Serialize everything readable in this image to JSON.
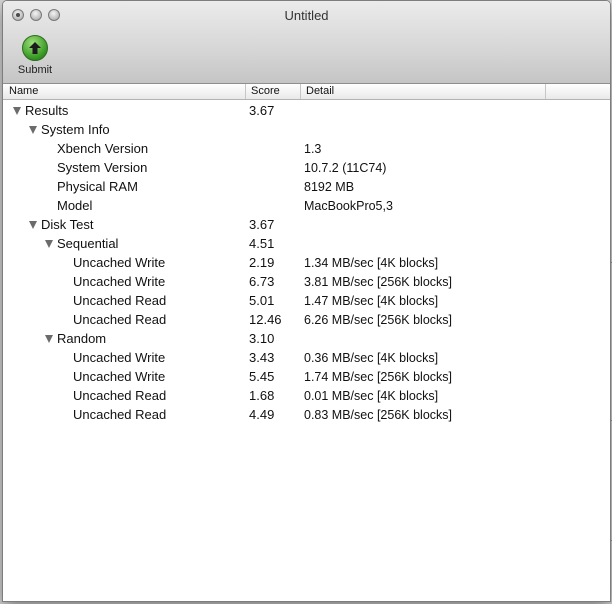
{
  "window": {
    "title": "Untitled"
  },
  "toolbar": {
    "submit_label": "Submit"
  },
  "columns": {
    "name": "Name",
    "score": "Score",
    "detail": "Detail"
  },
  "rows": [
    {
      "name": "Results",
      "score": "3.67",
      "detail": "",
      "level": 0,
      "expanded": true
    },
    {
      "name": "System Info",
      "score": "",
      "detail": "",
      "level": 1,
      "expanded": true
    },
    {
      "name": "Xbench Version",
      "score": "",
      "detail": "1.3",
      "level": 2
    },
    {
      "name": "System Version",
      "score": "",
      "detail": "10.7.2 (11C74)",
      "level": 2
    },
    {
      "name": "Physical RAM",
      "score": "",
      "detail": "8192 MB",
      "level": 2
    },
    {
      "name": "Model",
      "score": "",
      "detail": "MacBookPro5,3",
      "level": 2
    },
    {
      "name": "Disk Test",
      "score": "3.67",
      "detail": "",
      "level": 1,
      "expanded": true
    },
    {
      "name": "Sequential",
      "score": "4.51",
      "detail": "",
      "level": 2,
      "expanded": true
    },
    {
      "name": "Uncached Write",
      "score": "2.19",
      "detail": "1.34 MB/sec [4K blocks]",
      "level": 3
    },
    {
      "name": "Uncached Write",
      "score": "6.73",
      "detail": "3.81 MB/sec [256K blocks]",
      "level": 3
    },
    {
      "name": "Uncached Read",
      "score": "5.01",
      "detail": "1.47 MB/sec [4K blocks]",
      "level": 3
    },
    {
      "name": "Uncached Read",
      "score": "12.46",
      "detail": "6.26 MB/sec [256K blocks]",
      "level": 3
    },
    {
      "name": "Random",
      "score": "3.10",
      "detail": "",
      "level": 2,
      "expanded": true
    },
    {
      "name": "Uncached Write",
      "score": "3.43",
      "detail": "0.36 MB/sec [4K blocks]",
      "level": 3
    },
    {
      "name": "Uncached Write",
      "score": "5.45",
      "detail": "1.74 MB/sec [256K blocks]",
      "level": 3
    },
    {
      "name": "Uncached Read",
      "score": "1.68",
      "detail": "0.01 MB/sec [4K blocks]",
      "level": 3
    },
    {
      "name": "Uncached Read",
      "score": "4.49",
      "detail": "0.83 MB/sec [256K blocks]",
      "level": 3
    }
  ],
  "icons": {
    "submit": "green-up-arrow-icon",
    "disclosure": "disclosure-triangle-icon"
  },
  "colors": {
    "submit_green": "#3a9a26",
    "disclosure_gray": "#6b6b6b"
  }
}
